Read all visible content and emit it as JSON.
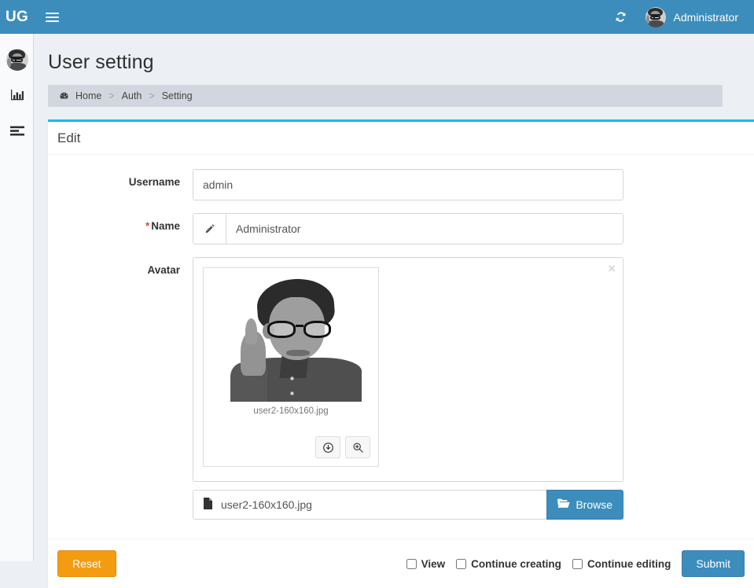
{
  "topbar": {
    "brand": "UG",
    "menu_toggle_label": "Toggle navigation",
    "sync_icon": "sync-icon",
    "user_name": "Administrator"
  },
  "sidebar": {
    "items": [
      {
        "icon": "user-avatar-icon",
        "label": ""
      },
      {
        "icon": "bar-chart-icon",
        "label": ""
      },
      {
        "icon": "list-align-icon",
        "label": ""
      }
    ]
  },
  "page": {
    "title": "User setting"
  },
  "breadcrumb": {
    "home_icon": "dashboard-icon",
    "items": [
      "Home",
      "Auth",
      "Setting"
    ],
    "separator": ">"
  },
  "box": {
    "title": "Edit",
    "accent_color": "#00c0ef"
  },
  "form": {
    "username": {
      "label": "Username",
      "value": "admin",
      "placeholder": ""
    },
    "name": {
      "label": "Name",
      "required_marker": "*",
      "value": "Administrator",
      "placeholder": "",
      "addon_icon": "pencil-icon"
    },
    "avatar": {
      "label": "Avatar",
      "close_icon": "×",
      "file_name": "user2-160x160.jpg",
      "download_icon": "download-circle-icon",
      "zoom_icon": "magnifier-plus-icon",
      "file_input_value": "user2-160x160.jpg",
      "file_icon": "file-icon",
      "browse_label": "Browse",
      "browse_icon": "folder-open-icon"
    }
  },
  "footer": {
    "reset_label": "Reset",
    "submit_label": "Submit",
    "checkboxes": [
      {
        "label": "View",
        "checked": false
      },
      {
        "label": "Continue creating",
        "checked": false
      },
      {
        "label": "Continue editing",
        "checked": false
      }
    ]
  },
  "colors": {
    "header_blue": "#3c8dbc",
    "accent_cyan": "#00c0ef",
    "reset_orange": "#f39c12",
    "required_red": "#dd4b39",
    "page_bg": "#ecf0f5",
    "breadcrumb_bg": "#d2d6de"
  }
}
